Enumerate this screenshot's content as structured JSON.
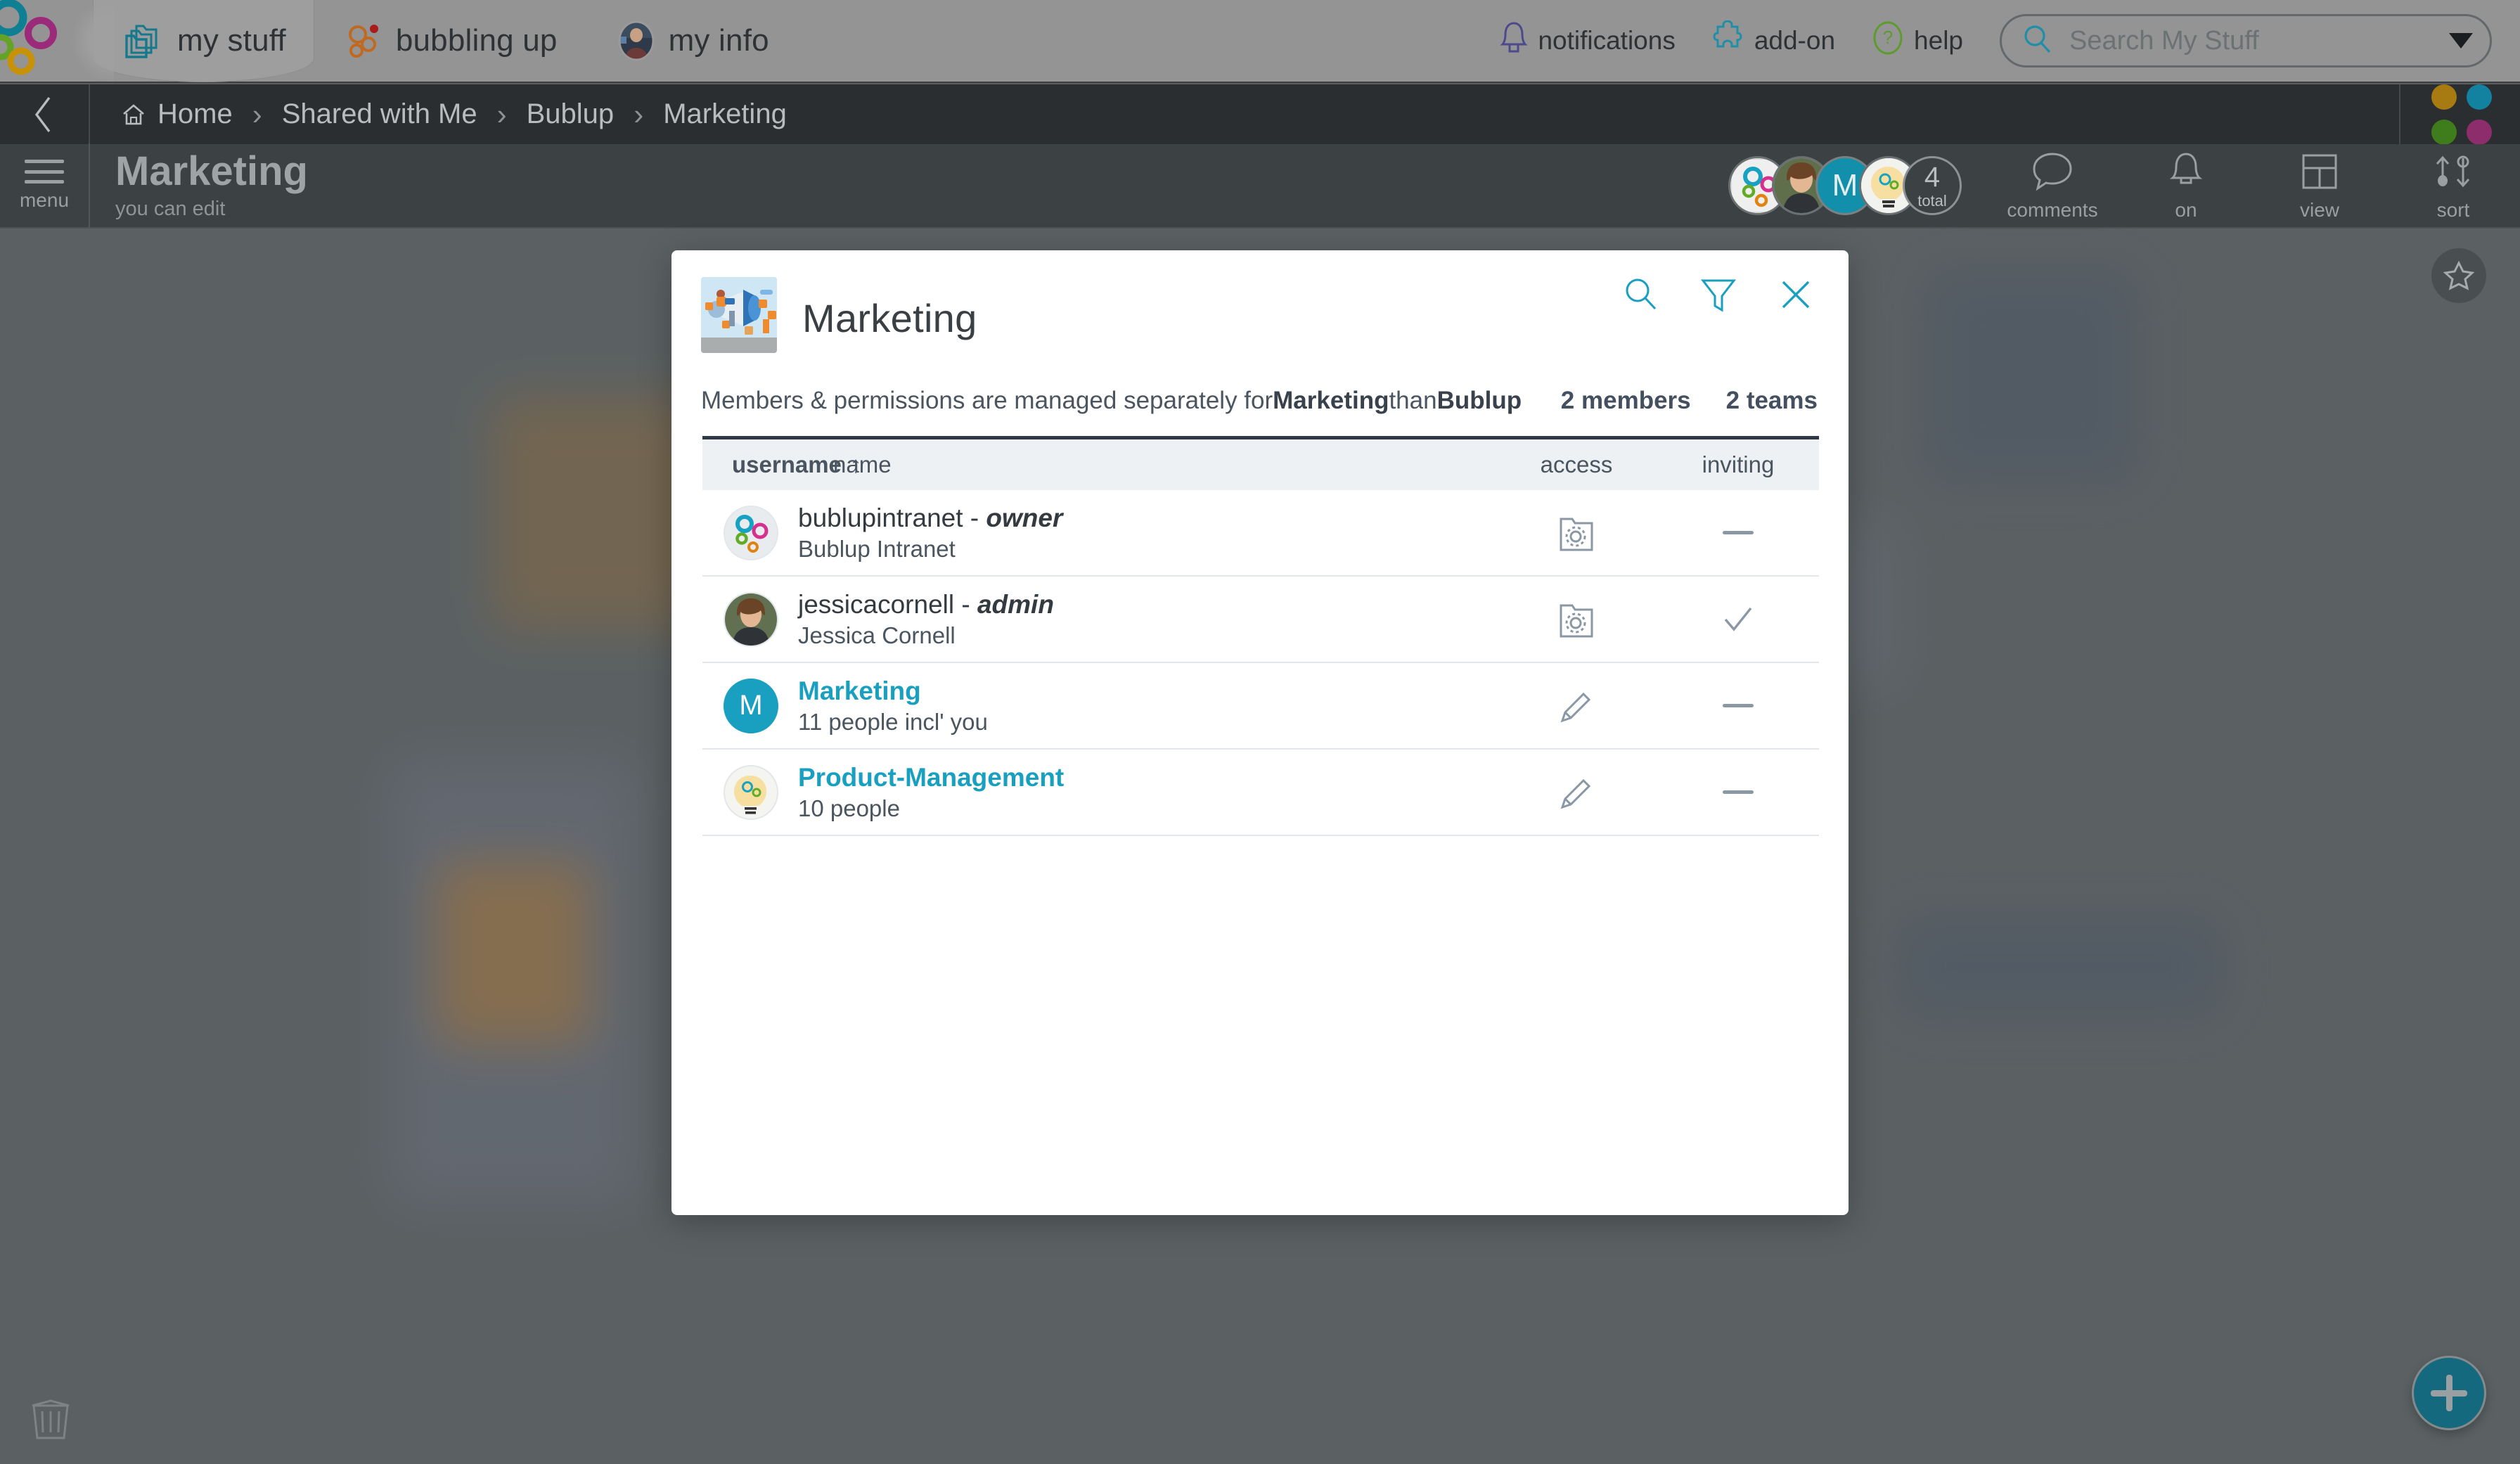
{
  "topnav": {
    "logo_name": "bublup-logo",
    "tabs": [
      {
        "label": "my stuff",
        "icon": "folders-icon",
        "active": true
      },
      {
        "label": "bubbling up",
        "icon": "bubbles-icon",
        "active": false,
        "badge": true
      },
      {
        "label": "my info",
        "icon": "user-avatar-icon",
        "active": false
      }
    ],
    "right_items": [
      {
        "label": "notifications",
        "icon": "bell-icon"
      },
      {
        "label": "add-on",
        "icon": "puzzle-piece-icon"
      },
      {
        "label": "help",
        "icon": "question-mark-icon"
      }
    ],
    "search": {
      "placeholder": "Search My Stuff",
      "value": "",
      "icon": "search-icon",
      "caret": "chevron-down-icon"
    }
  },
  "breadcrumb": {
    "back_icon": "chevron-left-icon",
    "home_icon": "home-icon",
    "separator": "›",
    "items": [
      "Home",
      "Shared with Me",
      "Bublup",
      "Marketing"
    ],
    "dots": [
      "#a77a12",
      "#1282a0",
      "#3f7c1c",
      "#8e2d6b"
    ]
  },
  "sectionbar": {
    "menu_label": "menu",
    "menu_icon": "hamburger-menu-icon",
    "title": "Marketing",
    "subtitle": "you can edit",
    "avatars": [
      {
        "type": "logo",
        "name": "bublup-intranet-avatar"
      },
      {
        "type": "photo",
        "name": "jessica-cornell-avatar"
      },
      {
        "type": "letter",
        "name": "marketing-team-avatar",
        "letter": "M"
      },
      {
        "type": "image",
        "name": "product-management-team-avatar"
      },
      {
        "type": "total",
        "name": "total-members-count",
        "count": "4",
        "caption": "total"
      }
    ],
    "tools": [
      {
        "label": "comments",
        "icon": "comment-bubble-icon"
      },
      {
        "label": "on",
        "icon": "bell-icon"
      },
      {
        "label": "view",
        "icon": "layout-grid-icon"
      },
      {
        "label": "sort",
        "icon": "sort-arrows-icon"
      }
    ]
  },
  "canvas": {
    "trash_icon": "trash-can-icon",
    "star_icon": "star-icon",
    "add_icon": "plus-icon"
  },
  "modal": {
    "thumbnail_name": "marketing-folder-thumbnail",
    "title": "Marketing",
    "actions": [
      {
        "name": "search-icon",
        "label": "search"
      },
      {
        "name": "filter-icon",
        "label": "filter"
      },
      {
        "name": "close-icon",
        "label": "close"
      }
    ],
    "note_prefix": "Members & permissions are managed separately for ",
    "note_bold_1": "Marketing",
    "note_middle": " than ",
    "note_bold_2": "Bublup",
    "members_count": "2 members",
    "teams_count": "2 teams",
    "table": {
      "columns": {
        "username": "username",
        "username_sort": "↑",
        "name": "name",
        "access": "access",
        "inviting": "inviting"
      },
      "rows": [
        {
          "avatar_type": "logo",
          "avatar_name": "bublup-logo-avatar",
          "username": "bublupintranet",
          "separator": " - ",
          "role": "owner",
          "name": "Bublup Intranet",
          "access_icon": "folder-gear-icon",
          "inviting": "dash",
          "is_link": false
        },
        {
          "avatar_type": "photo",
          "avatar_name": "jessica-cornell-photo-avatar",
          "username": "jessicacornell",
          "separator": " - ",
          "role": "admin",
          "name": "Jessica Cornell",
          "access_icon": "folder-gear-icon",
          "inviting": "check",
          "is_link": false
        },
        {
          "avatar_type": "letter",
          "avatar_name": "marketing-team-letter-avatar",
          "avatar_letter": "M",
          "username": "Marketing",
          "separator": "",
          "role": "",
          "name": "11 people incl' you",
          "access_icon": "pencil-icon",
          "inviting": "dash",
          "is_link": true
        },
        {
          "avatar_type": "image",
          "avatar_name": "product-management-team-avatar",
          "username": "Product-Management",
          "separator": "",
          "role": "",
          "name": "10 people",
          "access_icon": "pencil-icon",
          "inviting": "dash",
          "is_link": true
        }
      ]
    }
  },
  "colors": {
    "accent_teal": "#19a0c0",
    "dark_bar": "#3c4143",
    "crumb_bar": "#2b2e30",
    "topbar": "#949494",
    "canvas": "#5b6163",
    "fab": "#14697f"
  }
}
